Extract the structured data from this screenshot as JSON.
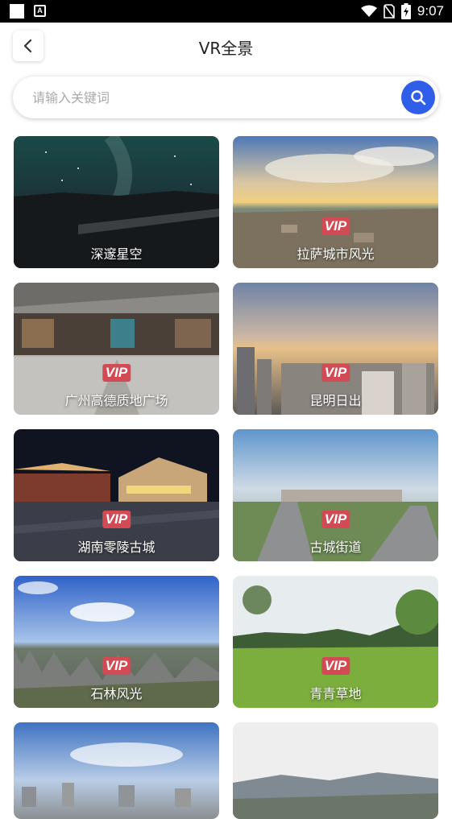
{
  "status_bar": {
    "time": "9:07",
    "icons": [
      "wifi-icon",
      "no-sim-icon",
      "battery-charging-icon"
    ]
  },
  "header": {
    "title": "VR全景",
    "back_icon": "chevron-left-icon"
  },
  "search": {
    "placeholder": "请输入关键词",
    "value": "",
    "button_icon": "search-icon",
    "accent": "#2f5fe8"
  },
  "vip_label": "VIP",
  "vip_color": "#d24b54",
  "scenes": [
    {
      "name": "深邃星空",
      "vip": false
    },
    {
      "name": "拉萨城市风光",
      "vip": true
    },
    {
      "name": "广州高德质地广场",
      "vip": true
    },
    {
      "name": "昆明日出",
      "vip": true
    },
    {
      "name": "湖南零陵古城",
      "vip": true
    },
    {
      "name": "古城街道",
      "vip": true
    },
    {
      "name": "石林风光",
      "vip": true
    },
    {
      "name": "青青草地",
      "vip": true
    },
    {
      "name": "",
      "vip": false
    },
    {
      "name": "",
      "vip": false
    }
  ]
}
